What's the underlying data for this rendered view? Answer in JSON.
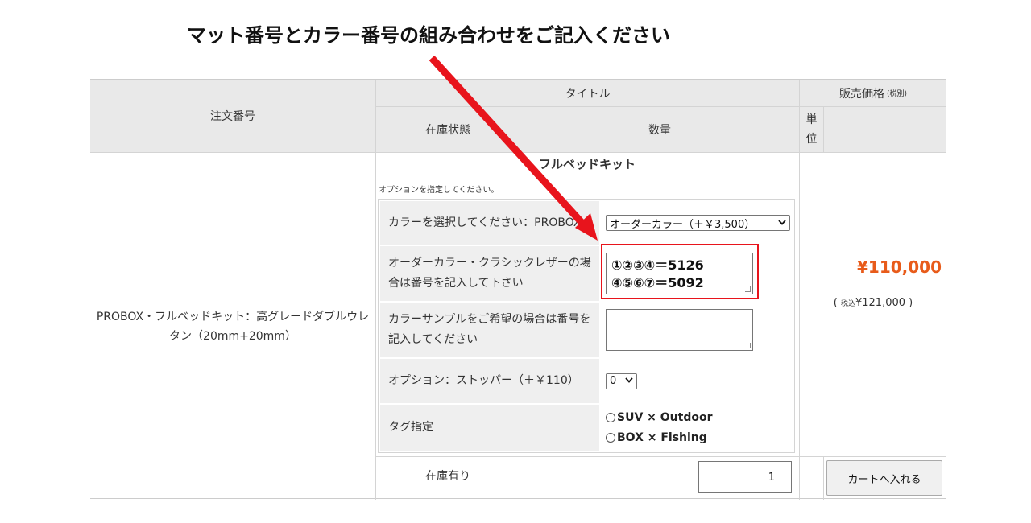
{
  "annotation": {
    "headline": "マット番号とカラー番号の組み合わせをご記入ください"
  },
  "table": {
    "header": {
      "order_number": "注文番号",
      "title": "タイトル",
      "price": "販売価格",
      "price_note": "(税別)",
      "stock_status": "在庫状態",
      "quantity": "数量",
      "unit_top": "単",
      "unit_bottom": "位"
    },
    "row": {
      "product_name": "PROBOX・フルベッドキット：高グレードダブルウレタン（20mm+20mm）",
      "kit_title": "フルベッドキット",
      "options_note": "オプションを指定してください。",
      "options": [
        {
          "label": "カラーを選択してください：PROBOX",
          "type": "select",
          "value": "オーダーカラー（＋￥3,500）"
        },
        {
          "label": "オーダーカラー・クラシックレザーの場合は番号を記入して下さい",
          "type": "textarea",
          "lines": [
            "①②③④＝5126",
            "④⑤⑥⑦＝5092"
          ]
        },
        {
          "label": "カラーサンプルをご希望の場合は番号を記入してください",
          "type": "textarea",
          "lines": []
        },
        {
          "label": "オプション：ストッパー（＋￥110）",
          "type": "select",
          "value": "0"
        },
        {
          "label": "タグ指定",
          "type": "radio",
          "choices": [
            "SUV × Outdoor",
            "BOX × Fishing"
          ]
        }
      ],
      "price": "¥110,000",
      "price_tax_open": "(",
      "price_tax_label": "税込",
      "price_tax_value": "¥121,000",
      "price_tax_close": ")",
      "stock_status": "在庫有り",
      "quantity": "1",
      "cart_button": "カートへ入れる"
    }
  },
  "colors": {
    "price": "#e85b1a",
    "highlight": "#e8141c",
    "header_bg": "#e9e9e9",
    "label_bg": "#efefef"
  },
  "icons": {
    "select_caret": "chevron-down-icon",
    "arrow": "red-arrow-icon"
  }
}
